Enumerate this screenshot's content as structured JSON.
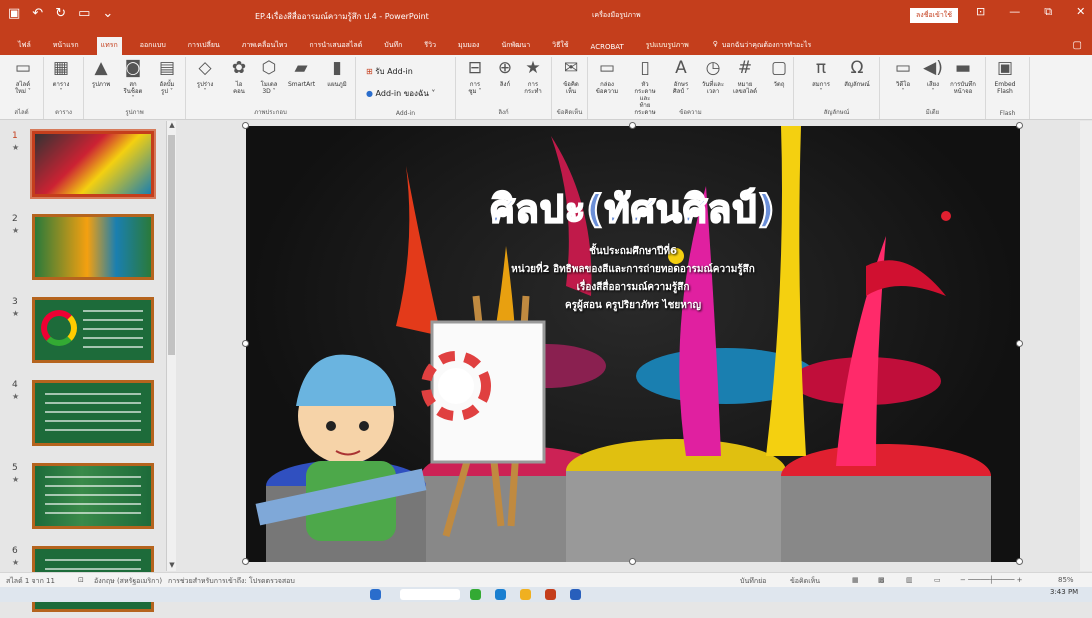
{
  "titlebar": {
    "doc_title": "EP.4เรื่องสีสื่ออารมณ์ความรู้สึก ป.4  -  PowerPoint",
    "context_label": "เครื่องมือรูปภาพ",
    "signin": "ลงชื่อเข้าใช้"
  },
  "tabs": [
    {
      "label": "ไฟล์",
      "name": "tab-file"
    },
    {
      "label": "หน้าแรก",
      "name": "tab-home"
    },
    {
      "label": "แทรก",
      "name": "tab-insert",
      "active": true
    },
    {
      "label": "ออกแบบ",
      "name": "tab-design"
    },
    {
      "label": "การเปลี่ยน",
      "name": "tab-transitions"
    },
    {
      "label": "ภาพเคลื่อนไหว",
      "name": "tab-animations"
    },
    {
      "label": "การนำเสนอสไลด์",
      "name": "tab-slideshow"
    },
    {
      "label": "บันทึก",
      "name": "tab-record"
    },
    {
      "label": "รีวิว",
      "name": "tab-review"
    },
    {
      "label": "มุมมอง",
      "name": "tab-view"
    },
    {
      "label": "นักพัฒนา",
      "name": "tab-developer"
    },
    {
      "label": "วิธีใช้",
      "name": "tab-help"
    },
    {
      "label": "ACROBAT",
      "name": "tab-acrobat"
    },
    {
      "label": "รูปแบบรูปภาพ",
      "name": "tab-picture-format",
      "ctx": true
    }
  ],
  "tellme": "บอกฉันว่าคุณต้องการทำอะไร",
  "ribbon": {
    "buttons": [
      {
        "name": "new-slide-button",
        "icon": "▭",
        "l1": "สไลด์",
        "l2": "ใหม่ ˅"
      },
      {
        "name": "table-button",
        "icon": "▦",
        "l1": "ตาราง",
        "l2": "˅"
      },
      {
        "name": "pictures-button",
        "icon": "▲",
        "l1": "รูปภาพ",
        "l2": ""
      },
      {
        "name": "screenshot-button",
        "icon": "◙",
        "l1": "สกรีนช็อต",
        "l2": "˅"
      },
      {
        "name": "photo-album-button",
        "icon": "▤",
        "l1": "อัลบั้ม",
        "l2": "รูป ˅"
      },
      {
        "name": "shapes-button",
        "icon": "◇",
        "l1": "รูปร่าง",
        "l2": "˅"
      },
      {
        "name": "icons-button",
        "icon": "✿",
        "l1": "ไอ",
        "l2": "คอน"
      },
      {
        "name": "3d-models-button",
        "icon": "⬡",
        "l1": "โมเดล",
        "l2": "3D ˅"
      },
      {
        "name": "smartart-button",
        "icon": "▰",
        "l1": "SmartArt",
        "l2": ""
      },
      {
        "name": "chart-button",
        "icon": "▮",
        "l1": "แผนภูมิ",
        "l2": ""
      },
      {
        "name": "zoom-button",
        "icon": "⊟",
        "l1": "การ",
        "l2": "ซูม ˅"
      },
      {
        "name": "link-button",
        "icon": "⊕",
        "l1": "ลิงก์",
        "l2": ""
      },
      {
        "name": "action-button",
        "icon": "★",
        "l1": "การ",
        "l2": "กระทำ"
      },
      {
        "name": "comment-button",
        "icon": "✉",
        "l1": "ข้อคิด",
        "l2": "เห็น"
      },
      {
        "name": "textbox-button",
        "icon": "▭",
        "l1": "กล่อง",
        "l2": "ข้อความ"
      },
      {
        "name": "header-footer-button",
        "icon": "▯",
        "l1": "หัวกระดาษและ",
        "l2": "ท้ายกระดาษ"
      },
      {
        "name": "wordart-button",
        "icon": "A",
        "l1": "อักษร",
        "l2": "ศิลป์ ˅"
      },
      {
        "name": "date-time-button",
        "icon": "◷",
        "l1": "วันที่และ",
        "l2": "เวลา"
      },
      {
        "name": "slide-number-button",
        "icon": "#",
        "l1": "หมาย",
        "l2": "เลขสไลด์"
      },
      {
        "name": "object-button",
        "icon": "▢",
        "l1": "วัตถุ",
        "l2": ""
      },
      {
        "name": "equation-button",
        "icon": "π",
        "l1": "สมการ",
        "l2": "˅"
      },
      {
        "name": "symbol-button",
        "icon": "Ω",
        "l1": "สัญลักษณ์",
        "l2": ""
      },
      {
        "name": "video-button",
        "icon": "▭",
        "l1": "วิดีโอ",
        "l2": "˅"
      },
      {
        "name": "audio-button",
        "icon": "◀)",
        "l1": "เสียง",
        "l2": "˅"
      },
      {
        "name": "screen-recording-button",
        "icon": "▬",
        "l1": "การบันทึก",
        "l2": "หน้าจอ"
      },
      {
        "name": "embed-flash-button",
        "icon": "▣",
        "l1": "Embed",
        "l2": "Flash"
      }
    ],
    "groups": [
      {
        "name": "group-slides",
        "label": "สไลด์"
      },
      {
        "name": "group-tables",
        "label": "ตาราง"
      },
      {
        "name": "group-images",
        "label": "รูปภาพ"
      },
      {
        "name": "group-illustrations",
        "label": "ภาพประกอบ"
      },
      {
        "name": "group-addins",
        "label": "Add-in"
      },
      {
        "name": "group-links",
        "label": "ลิงก์"
      },
      {
        "name": "group-comments",
        "label": "ข้อคิดเห็น"
      },
      {
        "name": "group-text",
        "label": "ข้อความ"
      },
      {
        "name": "group-symbols",
        "label": "สัญลักษณ์"
      },
      {
        "name": "group-media",
        "label": "มีเดีย"
      },
      {
        "name": "group-flash",
        "label": "Flash"
      }
    ],
    "get_addins": "รับ Add-in",
    "my_addins": "Add-in ของฉัน"
  },
  "thumbnails": [
    {
      "num": "1",
      "star": "★"
    },
    {
      "num": "2",
      "star": "★"
    },
    {
      "num": "3",
      "star": "★"
    },
    {
      "num": "4",
      "star": "★"
    },
    {
      "num": "5",
      "star": "★"
    },
    {
      "num": "6",
      "star": "★"
    }
  ],
  "slide": {
    "title": "ศิลปะ(ทัศนศิลป์)",
    "line1": "ชั้นประถมศึกษาปีที่6",
    "line2": "หน่วยที่2 อิทธิพลของสีและการถ่ายทอดอารมณ์ความรู้สึก",
    "line3": "เรื่องสีสื่ออารมณ์ความรู้สึก",
    "line4": "ครูผู้สอน ครูปริยาภัทร ไชยหาญ"
  },
  "status": {
    "slide_count": "สไลด์ 1 จาก 11",
    "language": "อังกฤษ (สหรัฐอเมริกา)",
    "accessibility": "การช่วยสำหรับการเข้าถึง: โปรดตรวจสอบ",
    "notes": "บันทึกย่อ",
    "comments": "ข้อคิดเห็น",
    "zoom": "85%"
  },
  "taskbar": {
    "time": "3:43 PM"
  }
}
